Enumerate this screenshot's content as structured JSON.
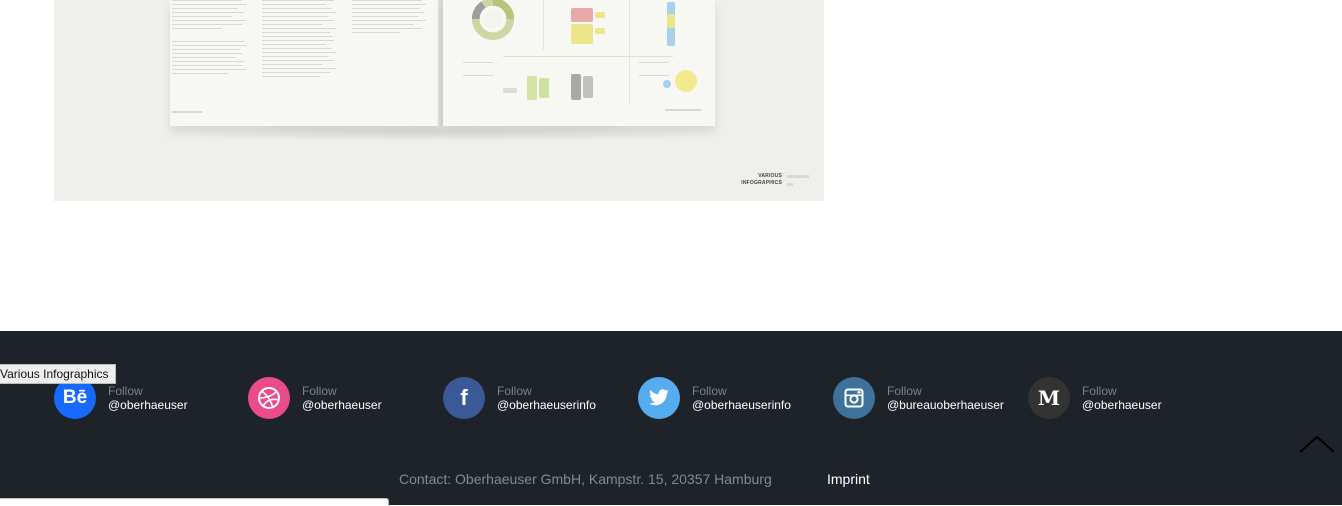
{
  "hero": {
    "corner_label_line1": "VARIOUS",
    "corner_label_line2": "INFOGRAPHICS"
  },
  "tooltip": "Various Infographics",
  "socials": [
    {
      "network": "behance",
      "icon": "behance-icon",
      "color": "#1769ff",
      "follow": "Follow",
      "handle": "@oberhaeuser"
    },
    {
      "network": "dribbble",
      "icon": "dribbble-icon",
      "color": "#ea4c89",
      "follow": "Follow",
      "handle": "@oberhaeuser"
    },
    {
      "network": "facebook",
      "icon": "facebook-icon",
      "color": "#3b5998",
      "follow": "Follow",
      "handle": "@oberhaeuserinfo"
    },
    {
      "network": "twitter",
      "icon": "twitter-icon",
      "color": "#55acee",
      "follow": "Follow",
      "handle": "@oberhaeuserinfo"
    },
    {
      "network": "instagram",
      "icon": "instagram-icon",
      "color": "#3f729b",
      "follow": "Follow",
      "handle": "@bureauoberhaeuser"
    },
    {
      "network": "medium",
      "icon": "medium-icon",
      "color": "#333333",
      "follow": "Follow",
      "handle": "@oberhaeuser"
    }
  ],
  "footer": {
    "contact": "Contact: Oberhaeuser GmbH, Kampstr. 15, 20357 Hamburg",
    "imprint": "Imprint"
  },
  "colors": {
    "footer_bg": "#1e2329",
    "hero_bg": "#efefeb"
  }
}
